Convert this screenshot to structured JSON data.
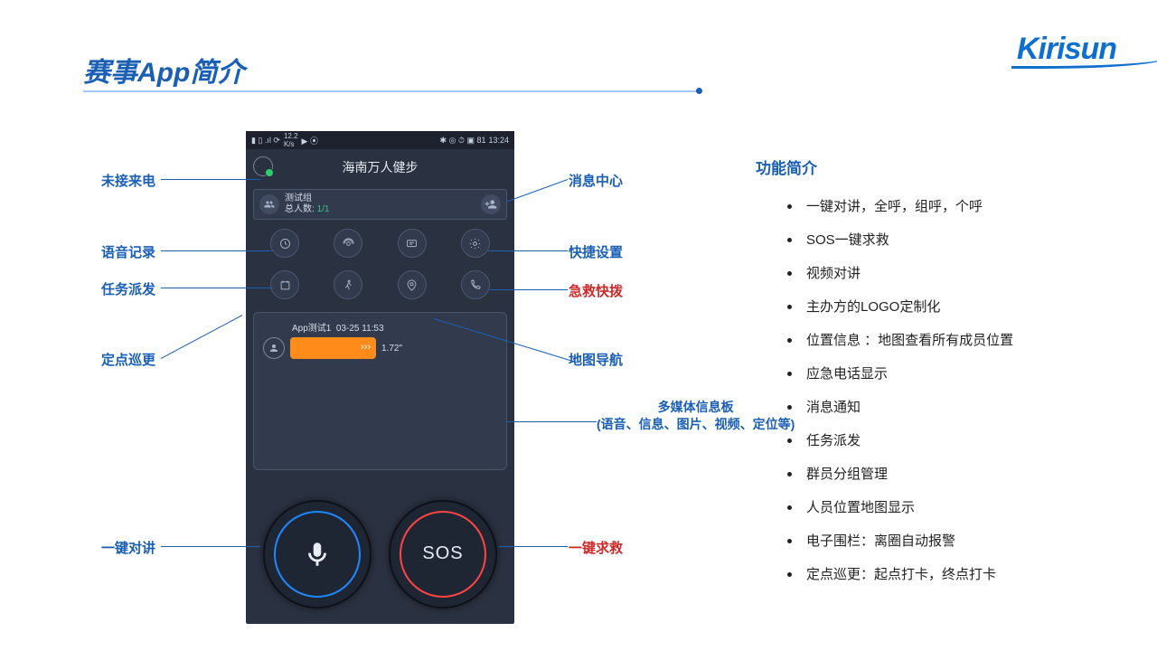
{
  "slide_title": "赛事App简介",
  "brand": "Kirisun",
  "phone": {
    "status_time": "13:24",
    "app_title": "海南万人健步",
    "group": {
      "name": "测试组",
      "count_label": "总人数:",
      "count": "1/1"
    },
    "msg": {
      "user": "App测试1",
      "time": "03-25 11:53",
      "duration": "1.72\""
    },
    "sos": "SOS"
  },
  "callouts": {
    "left": [
      "未接来电",
      "语音记录",
      "任务派发",
      "定点巡更",
      "一键对讲"
    ],
    "right_blue": [
      "消息中心",
      "快捷设置"
    ],
    "right_red": [
      "急救快拨",
      "一键求救"
    ],
    "map_nav": "地图导航",
    "board": "多媒体信息板\n(语音、信息、图片、视频、定位等)"
  },
  "features": {
    "title": "功能简介",
    "items": [
      "一键对讲，全呼，组呼，个呼",
      "SOS一键求救",
      "视频对讲",
      "主办方的LOGO定制化",
      "位置信息 ：地图查看所有成员位置",
      "应急电话显示",
      "消息通知",
      "任务派发",
      "群员分组管理",
      "人员位置地图显示",
      "电子围栏：离圈自动报警",
      "定点巡更：起点打卡，终点打卡"
    ]
  }
}
